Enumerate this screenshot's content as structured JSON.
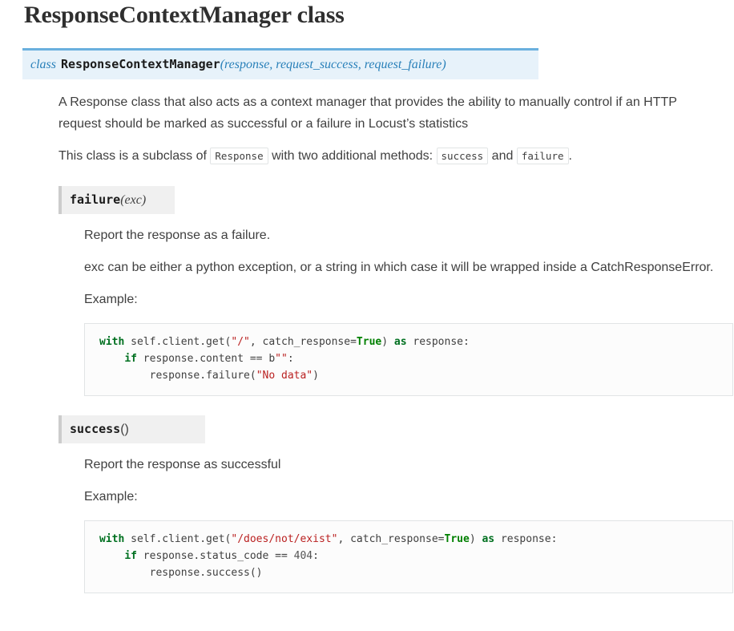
{
  "page": {
    "title": "ResponseContextManager class"
  },
  "class_signature": {
    "keyword": "class",
    "name": "ResponseContextManager",
    "params": "(response, request_success, request_failure)",
    "accent_border_color": "#6ab0de",
    "background_color": "#e7f2fa",
    "keyword_color": "#2980b9"
  },
  "description": {
    "paragraph_1": "A Response class that also acts as a context manager that provides the ability to manually control if an HTTP request should be marked as successful or a failure in Locust’s statistics",
    "subclass_line": {
      "part_1": "This class is a subclass of",
      "code_1": "Response",
      "part_2": "with two additional methods:",
      "code_2": "success",
      "part_3": "and",
      "code_3": "failure",
      "part_4": "."
    }
  },
  "methods": [
    {
      "name": "failure",
      "args": "(exc)",
      "paragraphs": [
        "Report the response as a failure.",
        "exc can be either a python exception, or a string in which case it will be wrapped inside a CatchResponseError.",
        "Example:"
      ],
      "code": {
        "line_1": {
          "kw_with": "with",
          "call": " self.client.get(",
          "str_path": "\"/\"",
          "mid": ", catch_response=",
          "kw_true": "True",
          "paren": ")",
          "kw_as": " as ",
          "tail": "response:"
        },
        "line_2": {
          "indent": "    ",
          "kw_if": "if",
          "expr": " response.content == b",
          "str_empty": "\"\"",
          "colon": ":"
        },
        "line_3": {
          "indent": "        ",
          "expr": "response.failure(",
          "str_arg": "\"No data\"",
          "close": ")"
        }
      }
    },
    {
      "name": "success",
      "args": "()",
      "paragraphs": [
        "Report the response as successful",
        "Example:"
      ],
      "code": {
        "line_1": {
          "kw_with": "with",
          "call": " self.client.get(",
          "str_path": "\"/does/not/exist\"",
          "mid": ", catch_response=",
          "kw_true": "True",
          "paren": ")",
          "kw_as": " as ",
          "tail": "response:"
        },
        "line_2": {
          "indent": "    ",
          "kw_if": "if",
          "expr": " response.status_code == ",
          "number": "404",
          "colon": ":"
        },
        "line_3": {
          "indent": "        ",
          "expr": "response.success()"
        }
      }
    }
  ],
  "syntax_colors": {
    "keyword": "#007020",
    "constant": "#008000",
    "string": "#ba2121",
    "text": "#404040"
  }
}
